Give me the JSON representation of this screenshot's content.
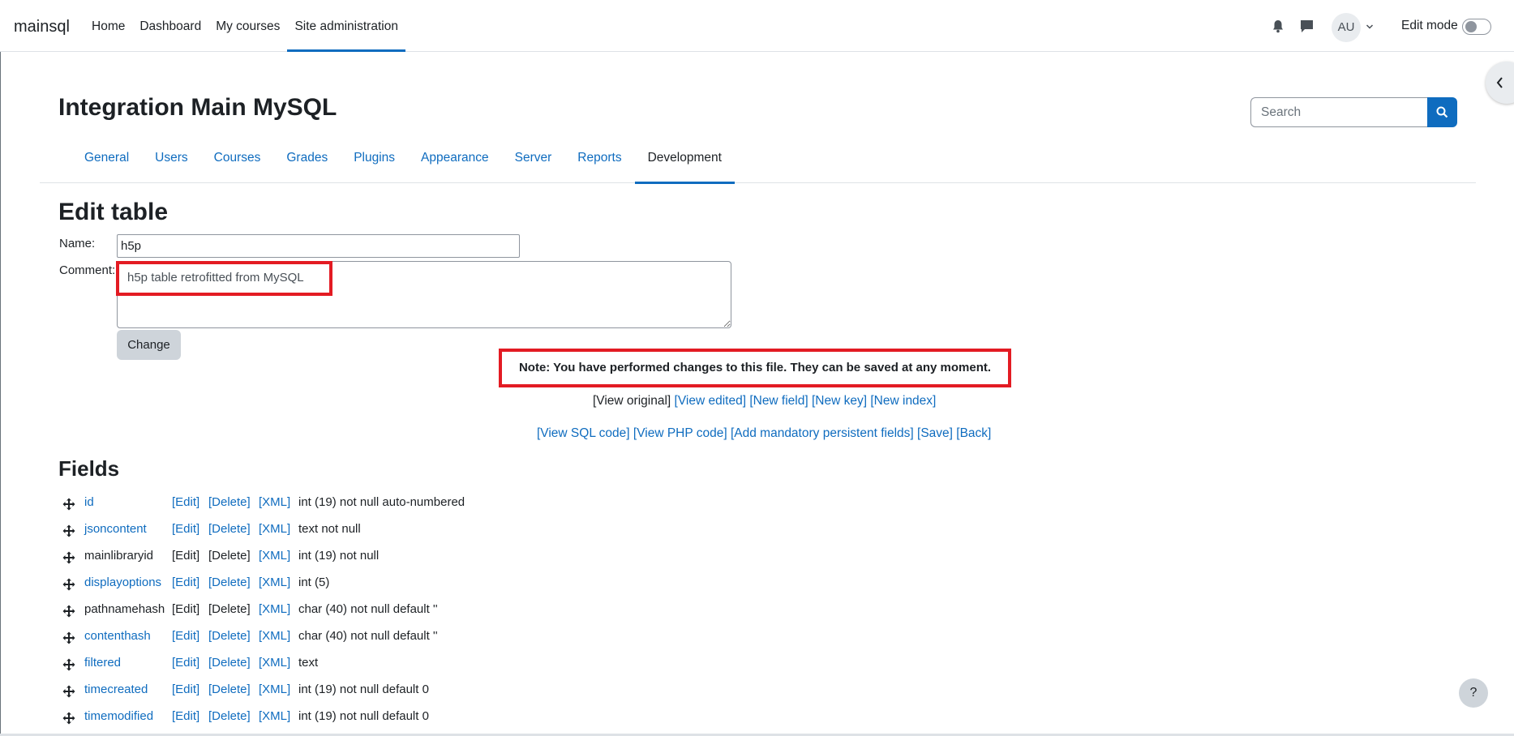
{
  "navbar": {
    "brand": "mainsql",
    "items": [
      {
        "label": "Home",
        "active": false
      },
      {
        "label": "Dashboard",
        "active": false
      },
      {
        "label": "My courses",
        "active": false
      },
      {
        "label": "Site administration",
        "active": true
      }
    ],
    "avatar_initials": "AU",
    "edit_mode_label": "Edit mode"
  },
  "header": {
    "title": "Integration Main MySQL",
    "search_placeholder": "Search"
  },
  "tabs": [
    {
      "label": "General",
      "active": false
    },
    {
      "label": "Users",
      "active": false
    },
    {
      "label": "Courses",
      "active": false
    },
    {
      "label": "Grades",
      "active": false
    },
    {
      "label": "Plugins",
      "active": false
    },
    {
      "label": "Appearance",
      "active": false
    },
    {
      "label": "Server",
      "active": false
    },
    {
      "label": "Reports",
      "active": false
    },
    {
      "label": "Development",
      "active": true
    }
  ],
  "edit_table": {
    "heading": "Edit table",
    "name_label": "Name:",
    "name_value": "h5p",
    "comment_label": "Comment:",
    "comment_value": "h5p table retrofitted from MySQL",
    "change_button": "Change",
    "note": "Note: You have performed changes to this file. They can be saved at any moment."
  },
  "actions_row1": {
    "view_original": "[View original]",
    "view_edited": "[View edited]",
    "new_field": "[New field]",
    "new_key": "[New key]",
    "new_index": "[New index]"
  },
  "actions_row2": {
    "view_sql": "[View SQL code]",
    "view_php": "[View PHP code]",
    "add_mandatory": "[Add mandatory persistent fields]",
    "save": "[Save]",
    "back": "[Back]"
  },
  "fields_heading": "Fields",
  "field_actions": {
    "edit": "[Edit]",
    "delete": "[Delete]",
    "xml": "[XML]"
  },
  "fields": [
    {
      "name": "id",
      "linked": true,
      "edit_linked": true,
      "delete_linked": true,
      "type": "int (19) not null auto-numbered"
    },
    {
      "name": "jsoncontent",
      "linked": true,
      "edit_linked": true,
      "delete_linked": true,
      "type": "text not null"
    },
    {
      "name": "mainlibraryid",
      "linked": false,
      "edit_linked": false,
      "delete_linked": false,
      "type": "int (19) not null"
    },
    {
      "name": "displayoptions",
      "linked": true,
      "edit_linked": true,
      "delete_linked": true,
      "type": "int (5)"
    },
    {
      "name": "pathnamehash",
      "linked": false,
      "edit_linked": false,
      "delete_linked": false,
      "type": "char (40) not null default ''"
    },
    {
      "name": "contenthash",
      "linked": true,
      "edit_linked": true,
      "delete_linked": true,
      "type": "char (40) not null default ''"
    },
    {
      "name": "filtered",
      "linked": true,
      "edit_linked": true,
      "delete_linked": true,
      "type": "text"
    },
    {
      "name": "timecreated",
      "linked": true,
      "edit_linked": true,
      "delete_linked": true,
      "type": "int (19) not null default 0"
    },
    {
      "name": "timemodified",
      "linked": true,
      "edit_linked": true,
      "delete_linked": true,
      "type": "int (19) not null default 0"
    }
  ],
  "help_button": "?",
  "colors": {
    "link": "#0f6cbf",
    "highlight": "#e31b23",
    "text": "#1d2125"
  }
}
